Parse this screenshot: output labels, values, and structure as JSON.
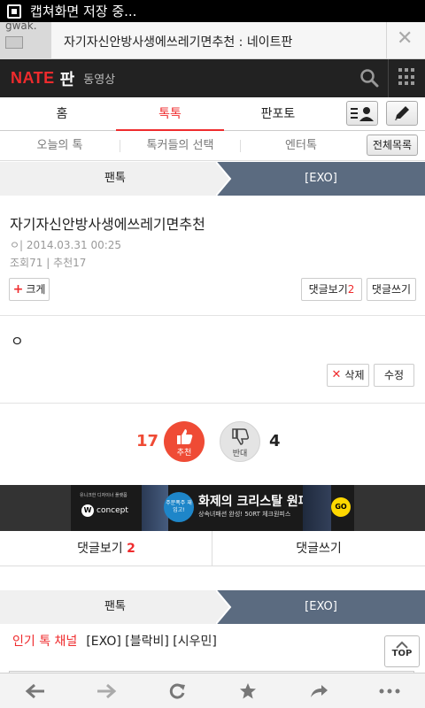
{
  "statusbar": {
    "text": "캡쳐화면 저장 중..."
  },
  "urlbar": {
    "thumb_text": "gwak.",
    "page_title": "자기자신안방사생에쓰레기면추천 : 네이트판"
  },
  "header": {
    "logo": "NATE",
    "section": "판",
    "sub_section": "동영상"
  },
  "main_tabs": [
    {
      "label": "홈"
    },
    {
      "label": "톡톡"
    },
    {
      "label": "판포토"
    }
  ],
  "sub_tabs": [
    {
      "label": "오늘의 톡"
    },
    {
      "label": "톡커들의 선택"
    },
    {
      "label": "엔터톡"
    }
  ],
  "all_list_label": "전체목록",
  "breadcrumb": {
    "left": "팬톡",
    "right": "[EXO]"
  },
  "post": {
    "title": "자기자신안방사생에쓰레기면추천",
    "author_mark": "ㅇ|",
    "datetime": "2014.03.31 00:25",
    "views_label": "조회",
    "views": "71",
    "recommend_label": "추천",
    "recommend": "17",
    "body": "ㅇ"
  },
  "buttons": {
    "enlarge": "크게",
    "view_comments": "댓글보기",
    "comment_count": "2",
    "write_comment": "댓글쓰기",
    "delete": "삭제",
    "edit": "수정"
  },
  "votes": {
    "up_count": "17",
    "up_label": "추천",
    "down_label": "반대",
    "down_count": "4"
  },
  "banner": {
    "brand_small": "유니크한 디자이너 플랫폼",
    "brand": "concept",
    "badge": "주문폭주 재입고!",
    "headline": "화제의 크리스탈 원피스",
    "sub": "상속녀패션 완성! 50RT 체크원피스",
    "go": "GO"
  },
  "comment_bar": {
    "view_label": "댓글보기",
    "count": "2",
    "write_label": "댓글쓰기"
  },
  "breadcrumb2": {
    "left": "팬톡",
    "right": "[EXO]"
  },
  "hot_channel": {
    "label": "인기 톡 채널",
    "value": "[EXO] [블락비] [시우민]"
  },
  "top_button": "TOP",
  "colors": {
    "accent": "#ef2b2d",
    "header_bg": "#222222",
    "crumb_active": "#5b6b80"
  }
}
